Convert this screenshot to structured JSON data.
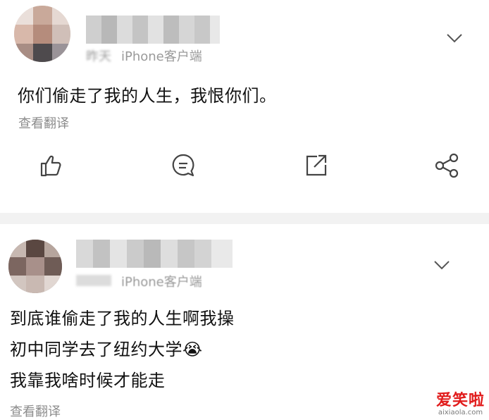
{
  "post1": {
    "meta_time": "昨天",
    "meta_client": "iPhone客户端",
    "content_lines": [
      "你们偷走了我的人生，我恨你们。"
    ],
    "translate_label": "查看翻译"
  },
  "post2": {
    "meta_client": "iPhone客户端",
    "content_lines": [
      "到底谁偷走了我的人生啊我操",
      "初中同学去了纽约大学😭",
      "我靠我啥时候才能走"
    ],
    "translate_label": "查看翻译"
  },
  "actions": [
    "like-icon",
    "comment-icon",
    "share-icon",
    "more-share-icon"
  ],
  "watermark": {
    "main": "爱笑啦",
    "sub": "aixiaola.com"
  },
  "colors": {
    "text": "#111111",
    "meta": "#9a9a9a",
    "icon": "#444444",
    "divider": "#f2f2f2",
    "watermark": "#e11c1c"
  }
}
